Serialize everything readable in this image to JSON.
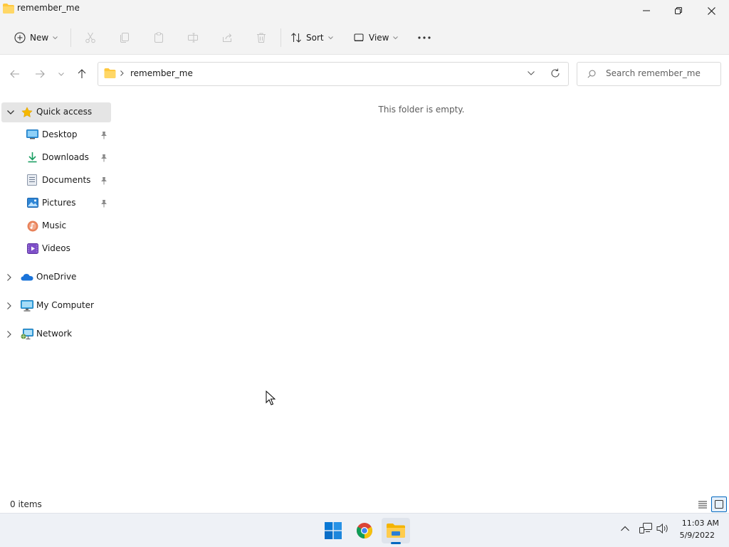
{
  "window": {
    "title": "remember_me"
  },
  "toolbar": {
    "new_label": "New",
    "sort_label": "Sort",
    "view_label": "View"
  },
  "address": {
    "path": "remember_me",
    "search_placeholder": "Search remember_me"
  },
  "sidebar": {
    "quick_access": "Quick access",
    "pinned": [
      {
        "label": "Desktop",
        "icon": "desktop-icon"
      },
      {
        "label": "Downloads",
        "icon": "download-icon"
      },
      {
        "label": "Documents",
        "icon": "documents-icon"
      },
      {
        "label": "Pictures",
        "icon": "pictures-icon"
      },
      {
        "label": "Music",
        "icon": "music-icon"
      },
      {
        "label": "Videos",
        "icon": "videos-icon"
      }
    ],
    "sections": [
      {
        "label": "OneDrive",
        "icon": "onedrive-icon"
      },
      {
        "label": "My Computer",
        "icon": "computer-icon"
      },
      {
        "label": "Network",
        "icon": "network-icon"
      }
    ]
  },
  "content": {
    "empty_message": "This folder is empty."
  },
  "status": {
    "item_count": "0 items"
  },
  "taskbar": {
    "apps": [
      "windows-start-icon",
      "chrome-icon",
      "file-explorer-icon"
    ],
    "time": "11:03 AM",
    "date": "5/9/2022"
  },
  "colors": {
    "accent": "#0067c0",
    "folder": "#ffc83d",
    "selected_bg": "#e5e5e5",
    "titlebar_bg": "#f3f3f3"
  }
}
